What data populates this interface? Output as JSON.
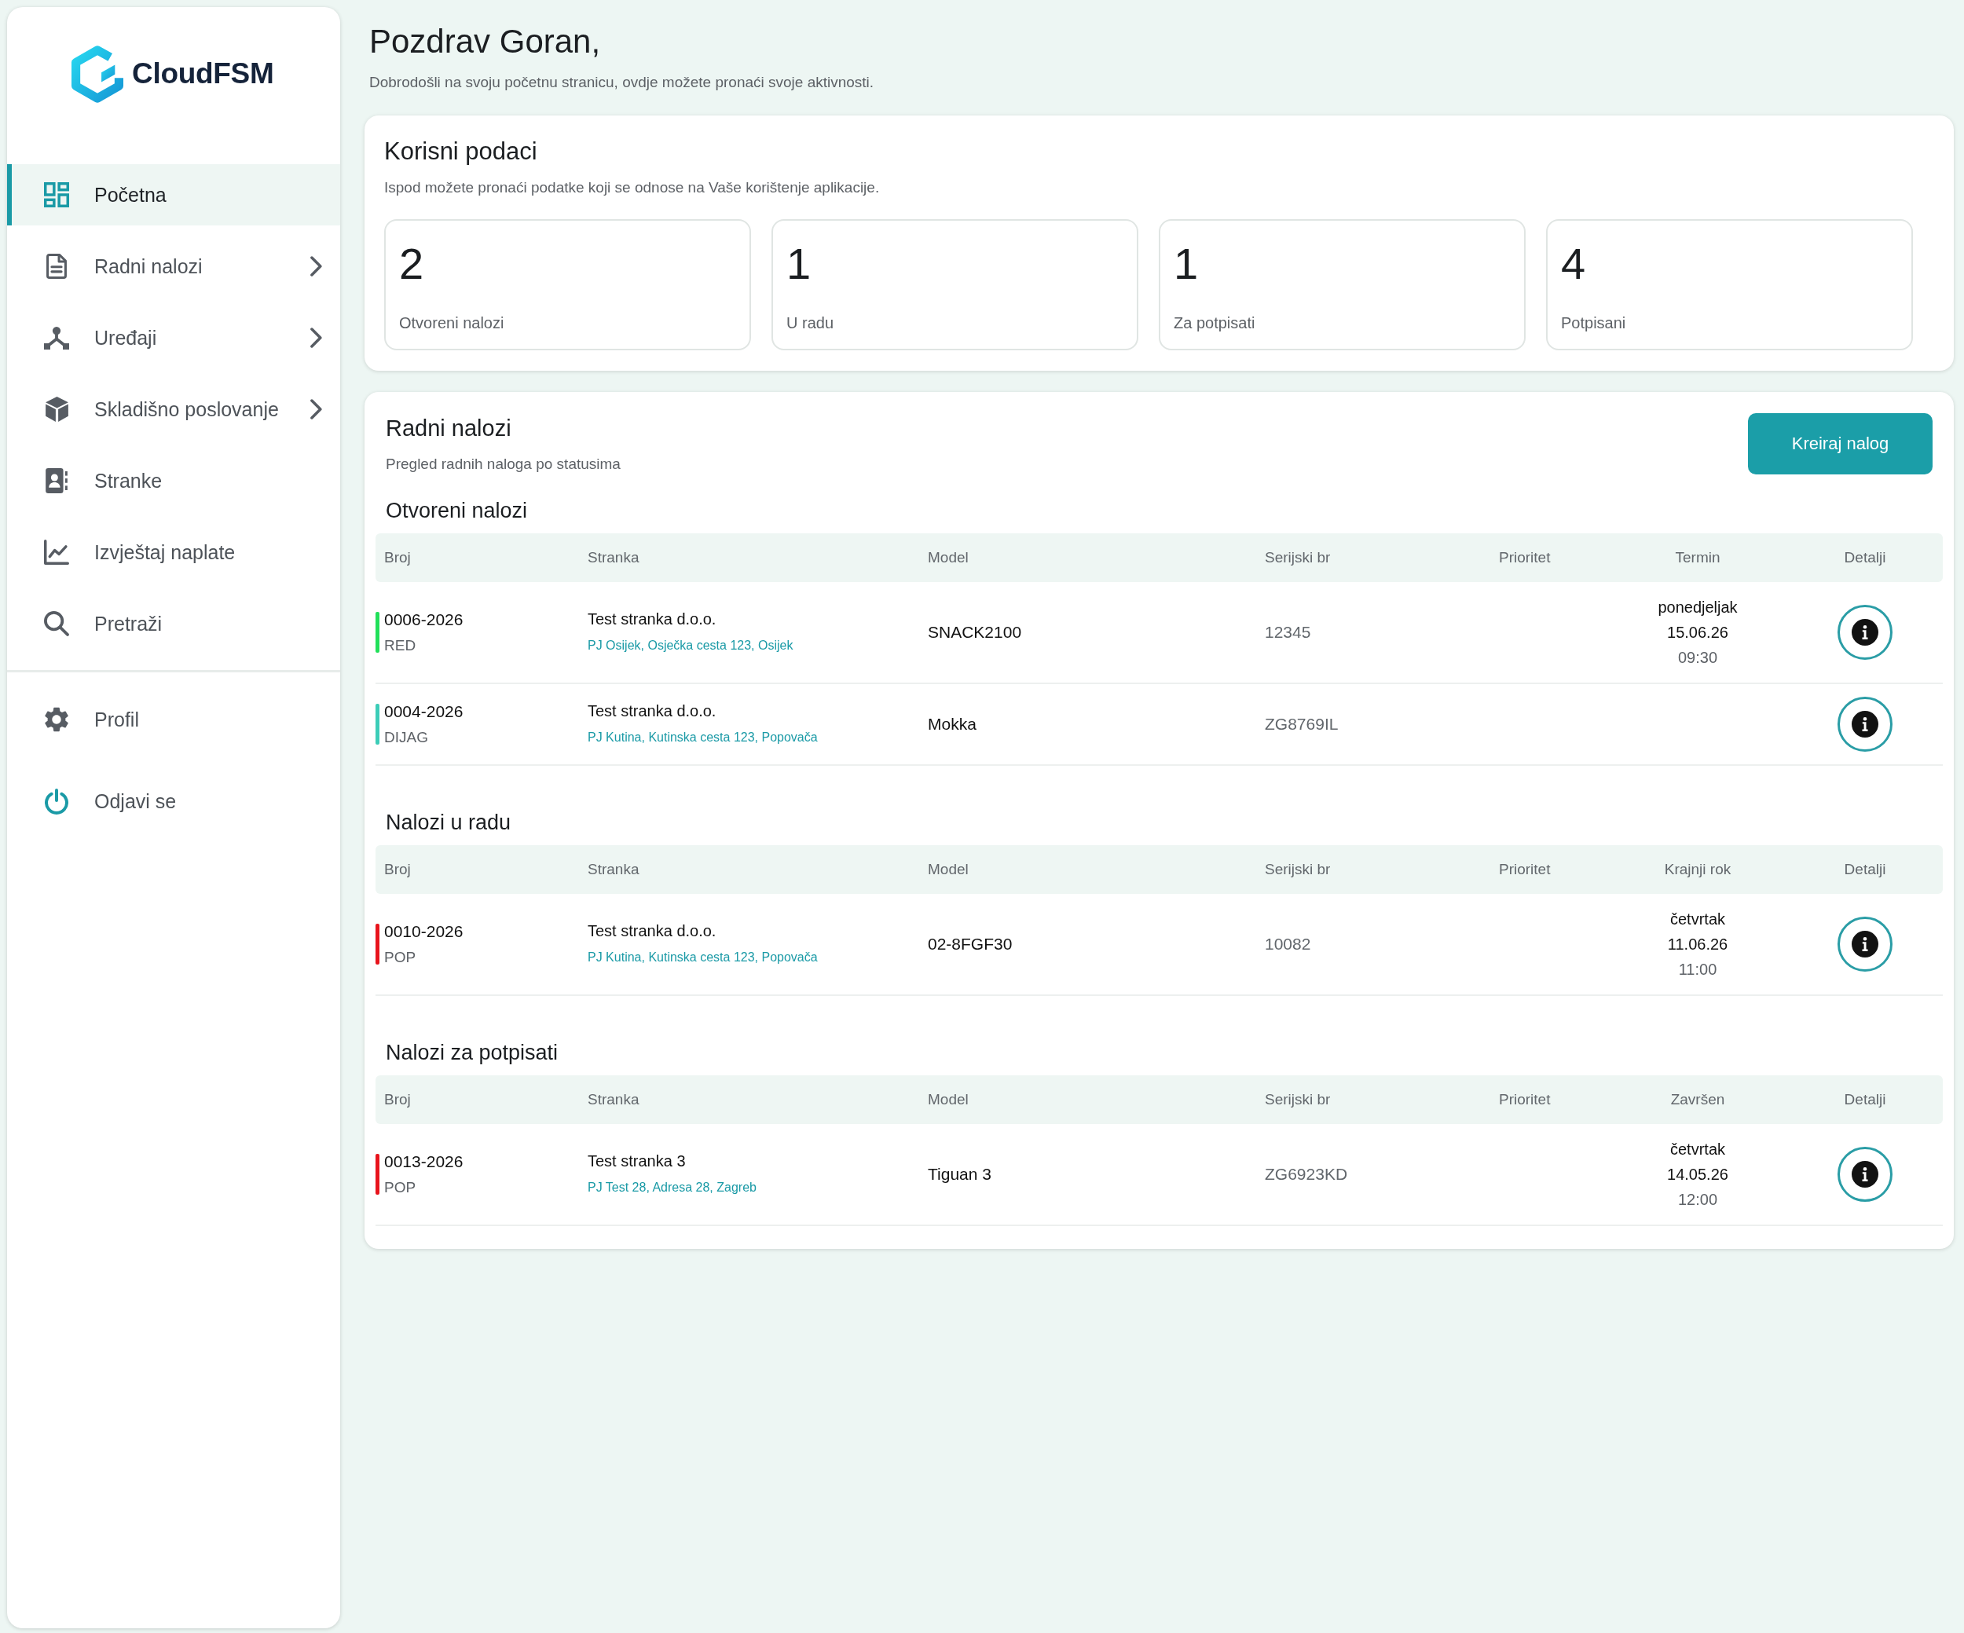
{
  "sidebar": {
    "logo": "CloudFSM",
    "items": [
      {
        "label": "Početna",
        "selected": true,
        "submenu": false
      },
      {
        "label": "Radni nalozi",
        "selected": false,
        "submenu": true
      },
      {
        "label": "Uređaji",
        "selected": false,
        "submenu": true
      },
      {
        "label": "Skladišno poslovanje",
        "selected": false,
        "submenu": true
      },
      {
        "label": "Stranke",
        "selected": false,
        "submenu": false
      },
      {
        "label": "Izvještaj naplate",
        "selected": false,
        "submenu": false
      },
      {
        "label": "Pretraži",
        "selected": false,
        "submenu": false
      }
    ],
    "bottom_items": [
      {
        "label": "Profil",
        "selected": false
      },
      {
        "label": "Odjavi se",
        "selected": false
      }
    ]
  },
  "header": {
    "title": "Pozdrav Goran,",
    "subtitle": "Dobrodošli na svoju početnu stranicu, ovdje možete pronaći svoje aktivnosti."
  },
  "stats": {
    "title": "Korisni podaci",
    "subtitle": "Ispod možete pronaći podatke koji se odnose na Vaše korištenje aplikacije.",
    "tiles": [
      {
        "value": "2",
        "label": "Otvoreni nalozi"
      },
      {
        "value": "1",
        "label": "U radu"
      },
      {
        "value": "1",
        "label": "Za potpisati"
      },
      {
        "value": "4",
        "label": "Potpisani"
      }
    ]
  },
  "orders": {
    "title": "Radni nalozi",
    "subtitle": "Pregled radnih naloga po statusima",
    "create_button": "Kreiraj nalog",
    "groups": [
      {
        "title": "Otvoreni nalozi",
        "columns": [
          "Broj",
          "Stranka",
          "Model",
          "Serijski br",
          "Prioritet",
          "Termin",
          "Detalji"
        ],
        "rows": [
          {
            "number": "0006-2026",
            "type": "RED",
            "color": "#22e05a",
            "client": "Test stranka d.o.o.",
            "address": "PJ Osijek, Osječka cesta 123, Osijek",
            "model": "SNACK2100",
            "serial": "12345",
            "date": {
              "day": "ponedjeljak",
              "date": "15.06.26",
              "time": "09:30"
            }
          },
          {
            "number": "0004-2026",
            "type": "DIJAG",
            "color": "#3ccdb8",
            "client": "Test stranka d.o.o.",
            "address": "PJ Kutina, Kutinska cesta 123, Popovača",
            "model": "Mokka",
            "serial": "ZG8769IL"
          }
        ]
      },
      {
        "title": "Nalozi u radu",
        "columns": [
          "Broj",
          "Stranka",
          "Model",
          "Serijski br",
          "Prioritet",
          "Krajnji rok",
          "Detalji"
        ],
        "rows": [
          {
            "number": "0010-2026",
            "type": "POP",
            "color": "#e8141c",
            "client": "Test stranka d.o.o.",
            "address": "PJ Kutina, Kutinska cesta 123, Popovača",
            "model": "02-8FGF30",
            "serial": "10082",
            "date": {
              "day": "četvrtak",
              "date": "11.06.26",
              "time": "11:00"
            }
          }
        ]
      },
      {
        "title": "Nalozi za potpisati",
        "columns": [
          "Broj",
          "Stranka",
          "Model",
          "Serijski br",
          "Prioritet",
          "Završen",
          "Detalji"
        ],
        "rows": [
          {
            "number": "0013-2026",
            "type": "POP",
            "color": "#e8141c",
            "client": "Test stranka 3",
            "address": "PJ Test 28, Adresa 28, Zagreb",
            "model": "Tiguan 3",
            "serial": "ZG6923KD",
            "date": {
              "day": "četvrtak",
              "date": "14.05.26",
              "time": "12:00"
            }
          }
        ]
      }
    ]
  }
}
